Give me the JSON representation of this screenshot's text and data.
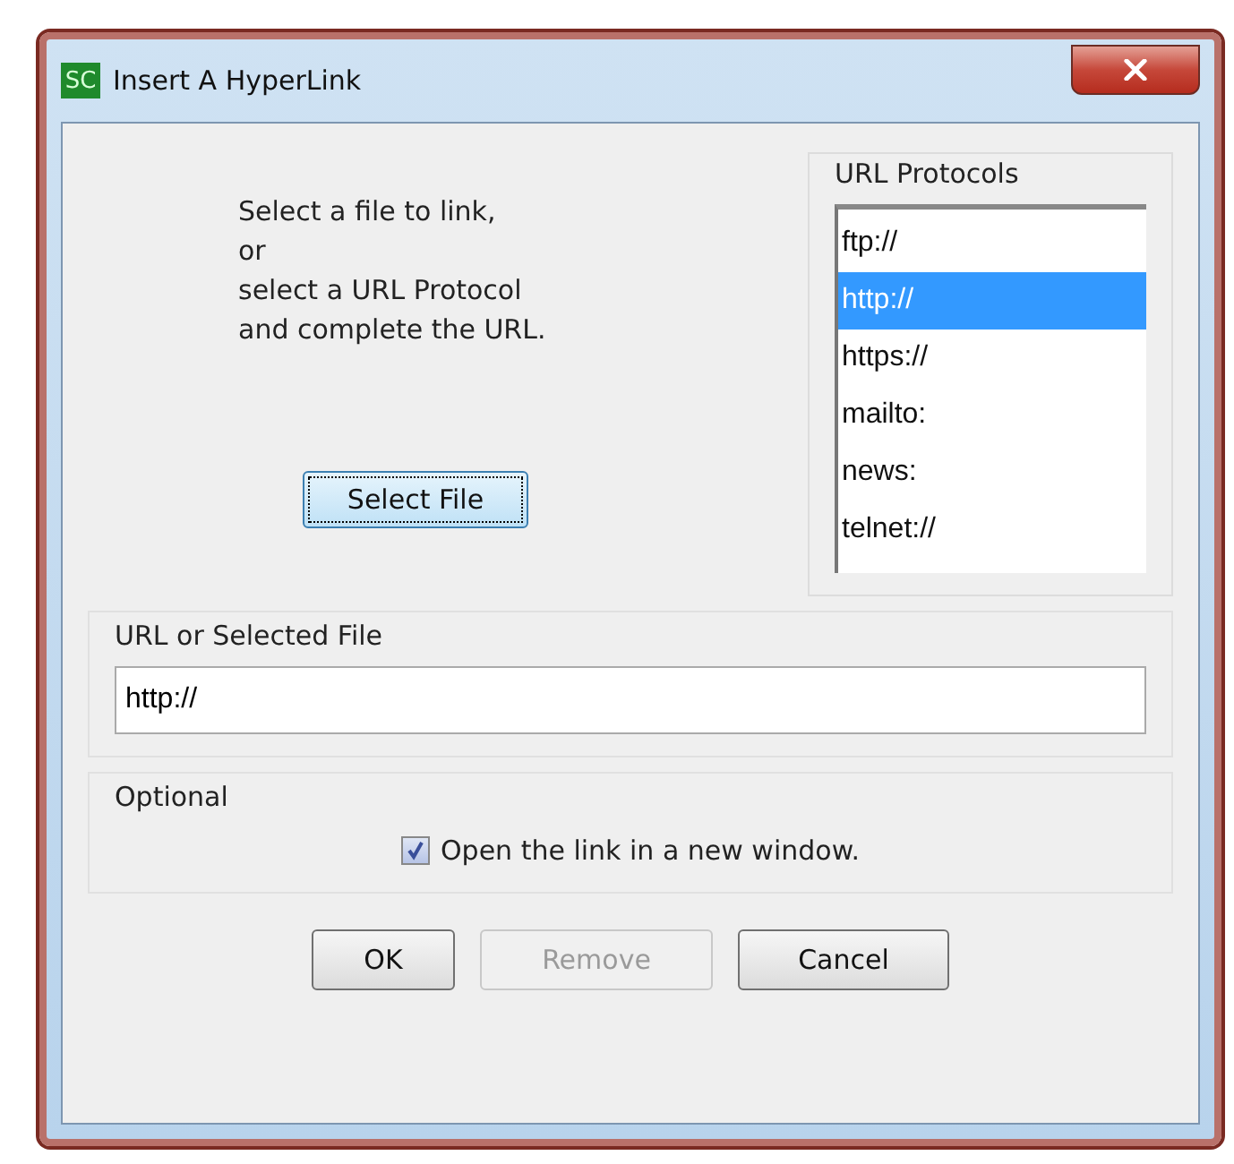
{
  "window": {
    "icon_text": "SC",
    "title": "Insert A HyperLink"
  },
  "instructions": [
    "Select a file to link,",
    "or",
    "select a URL Protocol",
    "and complete the URL."
  ],
  "select_file_button": {
    "label": "Select File",
    "focused": true
  },
  "url_protocols": {
    "title": "URL Protocols",
    "items": [
      {
        "label": "ftp://",
        "selected": false
      },
      {
        "label": "http://",
        "selected": true
      },
      {
        "label": "https://",
        "selected": false
      },
      {
        "label": "mailto:",
        "selected": false
      },
      {
        "label": "news:",
        "selected": false
      },
      {
        "label": "telnet://",
        "selected": false
      }
    ]
  },
  "url_group": {
    "title": "URL or Selected File",
    "value": "http://"
  },
  "optional_group": {
    "title": "Optional",
    "checkbox": {
      "label": "Open the link in a new window.",
      "checked": true
    }
  },
  "buttons": [
    {
      "label": "OK",
      "disabled": false
    },
    {
      "label": "Remove",
      "disabled": true
    },
    {
      "label": "Cancel",
      "disabled": false
    }
  ]
}
